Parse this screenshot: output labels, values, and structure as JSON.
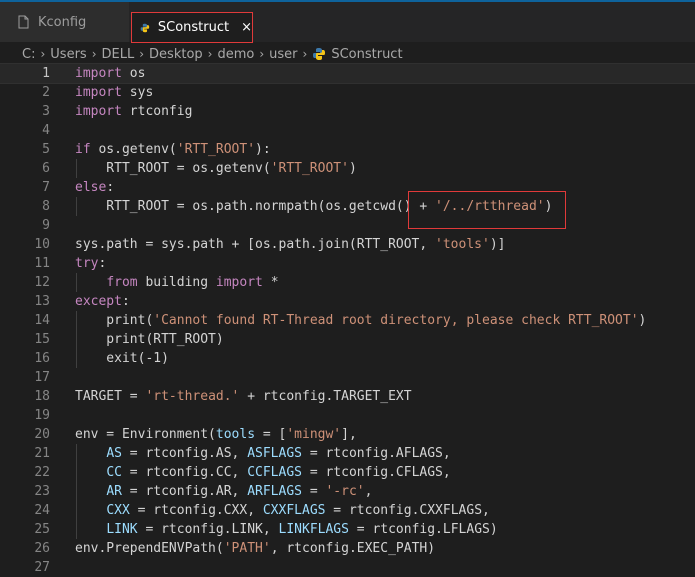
{
  "tabs": [
    {
      "label": "Kconfig",
      "icon": "file-icon",
      "active": false
    },
    {
      "label": "SConstruct",
      "icon": "python-icon",
      "active": true,
      "close": "×"
    }
  ],
  "breadcrumb": {
    "segments": [
      "C:",
      "Users",
      "DELL",
      "Desktop",
      "demo",
      "user",
      "SConstruct"
    ],
    "separator": "›"
  },
  "colors": {
    "keyword": "#c586c0",
    "string": "#ce9178",
    "param": "#9cdcfe",
    "text": "#d4d4d4",
    "highlight_box": "#e03a3a"
  },
  "editor": {
    "lines": [
      {
        "n": "1",
        "tokens": [
          [
            "k",
            "import"
          ],
          [
            "p",
            " os"
          ]
        ]
      },
      {
        "n": "2",
        "tokens": [
          [
            "k",
            "import"
          ],
          [
            "p",
            " sys"
          ]
        ]
      },
      {
        "n": "3",
        "tokens": [
          [
            "k",
            "import"
          ],
          [
            "p",
            " rtconfig"
          ]
        ]
      },
      {
        "n": "4",
        "tokens": []
      },
      {
        "n": "5",
        "tokens": [
          [
            "k",
            "if"
          ],
          [
            "p",
            " os.getenv("
          ],
          [
            "s",
            "'RTT_ROOT'"
          ],
          [
            "p",
            "):"
          ]
        ]
      },
      {
        "n": "6",
        "tokens": [
          [
            "p",
            "    RTT_ROOT = os.getenv("
          ],
          [
            "s",
            "'RTT_ROOT'"
          ],
          [
            "p",
            ")"
          ]
        ]
      },
      {
        "n": "7",
        "tokens": [
          [
            "k",
            "else"
          ],
          [
            "p",
            ":"
          ]
        ]
      },
      {
        "n": "8",
        "tokens": [
          [
            "p",
            "    RTT_ROOT = os.path.normpath(os.getcwd() + "
          ],
          [
            "s",
            "'/../rtthread'"
          ],
          [
            "p",
            ")"
          ]
        ]
      },
      {
        "n": "9",
        "tokens": []
      },
      {
        "n": "10",
        "tokens": [
          [
            "p",
            "sys.path = sys.path + [os.path.join(RTT_ROOT, "
          ],
          [
            "s",
            "'tools'"
          ],
          [
            "p",
            ")]"
          ]
        ]
      },
      {
        "n": "11",
        "tokens": [
          [
            "k",
            "try"
          ],
          [
            "p",
            ":"
          ]
        ]
      },
      {
        "n": "12",
        "tokens": [
          [
            "p",
            "    "
          ],
          [
            "k",
            "from"
          ],
          [
            "p",
            " building "
          ],
          [
            "k",
            "import"
          ],
          [
            "p",
            " *"
          ]
        ]
      },
      {
        "n": "13",
        "tokens": [
          [
            "k",
            "except"
          ],
          [
            "p",
            ":"
          ]
        ]
      },
      {
        "n": "14",
        "tokens": [
          [
            "p",
            "    print("
          ],
          [
            "s",
            "'Cannot found RT-Thread root directory, please check RTT_ROOT'"
          ],
          [
            "p",
            ")"
          ]
        ]
      },
      {
        "n": "15",
        "tokens": [
          [
            "p",
            "    print(RTT_ROOT)"
          ]
        ]
      },
      {
        "n": "16",
        "tokens": [
          [
            "p",
            "    exit(-1)"
          ]
        ]
      },
      {
        "n": "17",
        "tokens": []
      },
      {
        "n": "18",
        "tokens": [
          [
            "p",
            "TARGET = "
          ],
          [
            "s",
            "'rt-thread.'"
          ],
          [
            "p",
            " + rtconfig.TARGET_EXT"
          ]
        ]
      },
      {
        "n": "19",
        "tokens": []
      },
      {
        "n": "20",
        "tokens": [
          [
            "p",
            "env = Environment("
          ],
          [
            "v",
            "tools"
          ],
          [
            "p",
            " = ["
          ],
          [
            "s",
            "'mingw'"
          ],
          [
            "p",
            "],"
          ]
        ]
      },
      {
        "n": "21",
        "tokens": [
          [
            "p",
            "    "
          ],
          [
            "v",
            "AS"
          ],
          [
            "p",
            " = rtconfig.AS, "
          ],
          [
            "v",
            "ASFLAGS"
          ],
          [
            "p",
            " = rtconfig.AFLAGS,"
          ]
        ]
      },
      {
        "n": "22",
        "tokens": [
          [
            "p",
            "    "
          ],
          [
            "v",
            "CC"
          ],
          [
            "p",
            " = rtconfig.CC, "
          ],
          [
            "v",
            "CCFLAGS"
          ],
          [
            "p",
            " = rtconfig.CFLAGS,"
          ]
        ]
      },
      {
        "n": "23",
        "tokens": [
          [
            "p",
            "    "
          ],
          [
            "v",
            "AR"
          ],
          [
            "p",
            " = rtconfig.AR, "
          ],
          [
            "v",
            "ARFLAGS"
          ],
          [
            "p",
            " = "
          ],
          [
            "s",
            "'-rc'"
          ],
          [
            "p",
            ","
          ]
        ]
      },
      {
        "n": "24",
        "tokens": [
          [
            "p",
            "    "
          ],
          [
            "v",
            "CXX"
          ],
          [
            "p",
            " = rtconfig.CXX, "
          ],
          [
            "v",
            "CXXFLAGS"
          ],
          [
            "p",
            " = rtconfig.CXXFLAGS,"
          ]
        ]
      },
      {
        "n": "25",
        "tokens": [
          [
            "p",
            "    "
          ],
          [
            "v",
            "LINK"
          ],
          [
            "p",
            " = rtconfig.LINK, "
          ],
          [
            "v",
            "LINKFLAGS"
          ],
          [
            "p",
            " = rtconfig.LFLAGS)"
          ]
        ]
      },
      {
        "n": "26",
        "tokens": [
          [
            "p",
            "env.PrependENVPath("
          ],
          [
            "s",
            "'PATH'"
          ],
          [
            "p",
            ", rtconfig.EXEC_PATH)"
          ]
        ]
      },
      {
        "n": "27",
        "tokens": []
      }
    ]
  }
}
